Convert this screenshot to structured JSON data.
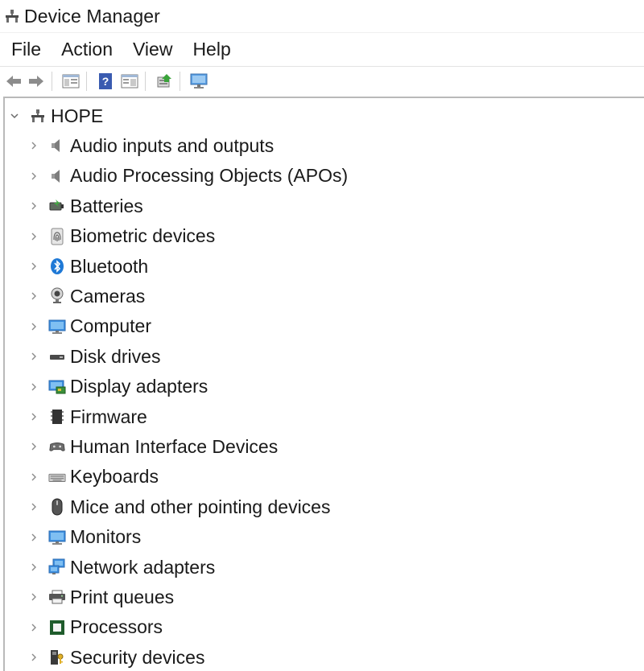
{
  "window": {
    "title": "Device Manager"
  },
  "menu": [
    "File",
    "Action",
    "View",
    "Help"
  ],
  "toolbar": [
    {
      "name": "back-button",
      "icon": "back-arrow-icon"
    },
    {
      "name": "forward-button",
      "icon": "forward-arrow-icon"
    },
    {
      "name": "show-hide-console-tree-button",
      "icon": "console-tree-icon"
    },
    {
      "name": "help-button",
      "icon": "help-icon"
    },
    {
      "name": "show-action-pane-button",
      "icon": "action-pane-icon"
    },
    {
      "name": "update-driver-button",
      "icon": "update-driver-icon"
    },
    {
      "name": "scan-hardware-button",
      "icon": "monitor-scan-icon"
    }
  ],
  "tree": {
    "root": "HOPE",
    "categories": [
      {
        "label": "Audio inputs and outputs",
        "icon": "speaker-icon"
      },
      {
        "label": "Audio Processing Objects (APOs)",
        "icon": "speaker-icon"
      },
      {
        "label": "Batteries",
        "icon": "battery-icon"
      },
      {
        "label": "Biometric devices",
        "icon": "fingerprint-icon"
      },
      {
        "label": "Bluetooth",
        "icon": "bluetooth-icon"
      },
      {
        "label": "Cameras",
        "icon": "webcam-icon"
      },
      {
        "label": "Computer",
        "icon": "computer-icon"
      },
      {
        "label": "Disk drives",
        "icon": "disk-drive-icon"
      },
      {
        "label": "Display adapters",
        "icon": "display-adapter-icon"
      },
      {
        "label": "Firmware",
        "icon": "firmware-chip-icon"
      },
      {
        "label": "Human Interface Devices",
        "icon": "hid-icon"
      },
      {
        "label": "Keyboards",
        "icon": "keyboard-icon"
      },
      {
        "label": "Mice and other pointing devices",
        "icon": "mouse-icon"
      },
      {
        "label": "Monitors",
        "icon": "monitor-icon"
      },
      {
        "label": "Network adapters",
        "icon": "network-adapter-icon"
      },
      {
        "label": "Print queues",
        "icon": "printer-icon"
      },
      {
        "label": "Processors",
        "icon": "processor-icon"
      },
      {
        "label": "Security devices",
        "icon": "security-device-icon"
      }
    ]
  },
  "colors": {
    "accent": "#2f7fd6",
    "chevron": "#8a8a8a"
  }
}
